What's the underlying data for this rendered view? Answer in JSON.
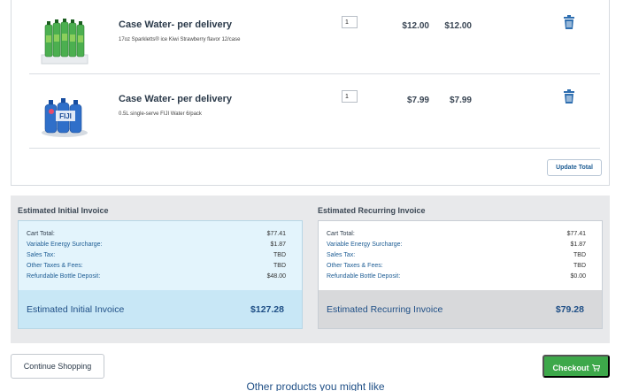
{
  "cart": {
    "items": [
      {
        "title": "Case Water- per delivery",
        "description": "17oz Sparkletts® ice Kiwi Strawberry flavor 12/case",
        "quantity": "1",
        "unit_price": "$12.00",
        "total_price": "$12.00",
        "image_icon": "green-bottles-case-image"
      },
      {
        "title": "Case Water- per delivery",
        "description": "0.5L single-serve FIJI Water 6/pack",
        "quantity": "1",
        "unit_price": "$7.99",
        "total_price": "$7.99",
        "image_icon": "fiji-water-pack-image"
      }
    ],
    "update_label": "Update Total"
  },
  "invoice_initial": {
    "heading": "Estimated Initial Invoice",
    "lines": [
      {
        "label": "Cart Total:",
        "value": "$77.41"
      },
      {
        "label": "Variable Energy Surcharge:",
        "value": "$1.87"
      },
      {
        "label": "Sales Tax:",
        "value": "TBD"
      },
      {
        "label": "Other Taxes & Fees:",
        "value": "TBD"
      },
      {
        "label": "Refundable Bottle Deposit:",
        "value": "$48.00"
      }
    ],
    "total_label": "Estimated Initial Invoice",
    "total_value": "$127.28"
  },
  "invoice_recurring": {
    "heading": "Estimated Recurring Invoice",
    "lines": [
      {
        "label": "Cart Total:",
        "value": "$77.41"
      },
      {
        "label": "Variable Energy Surcharge:",
        "value": "$1.87"
      },
      {
        "label": "Sales Tax:",
        "value": "TBD"
      },
      {
        "label": "Other Taxes & Fees:",
        "value": "TBD"
      },
      {
        "label": "Refundable Bottle Deposit:",
        "value": "$0.00"
      }
    ],
    "total_label": "Estimated Recurring Invoice",
    "total_value": "$79.28"
  },
  "actions": {
    "continue_label": "Continue Shopping",
    "checkout_label": "Checkout",
    "checkout_icon": "cart-icon"
  },
  "recommendations": {
    "heading": "Other products you might like"
  },
  "colors": {
    "accent_blue": "#1e5d94",
    "checkout_green": "#3da84a",
    "initial_box_bg": "#e3f4fc",
    "recurring_footer_bg": "#d8d9db"
  }
}
